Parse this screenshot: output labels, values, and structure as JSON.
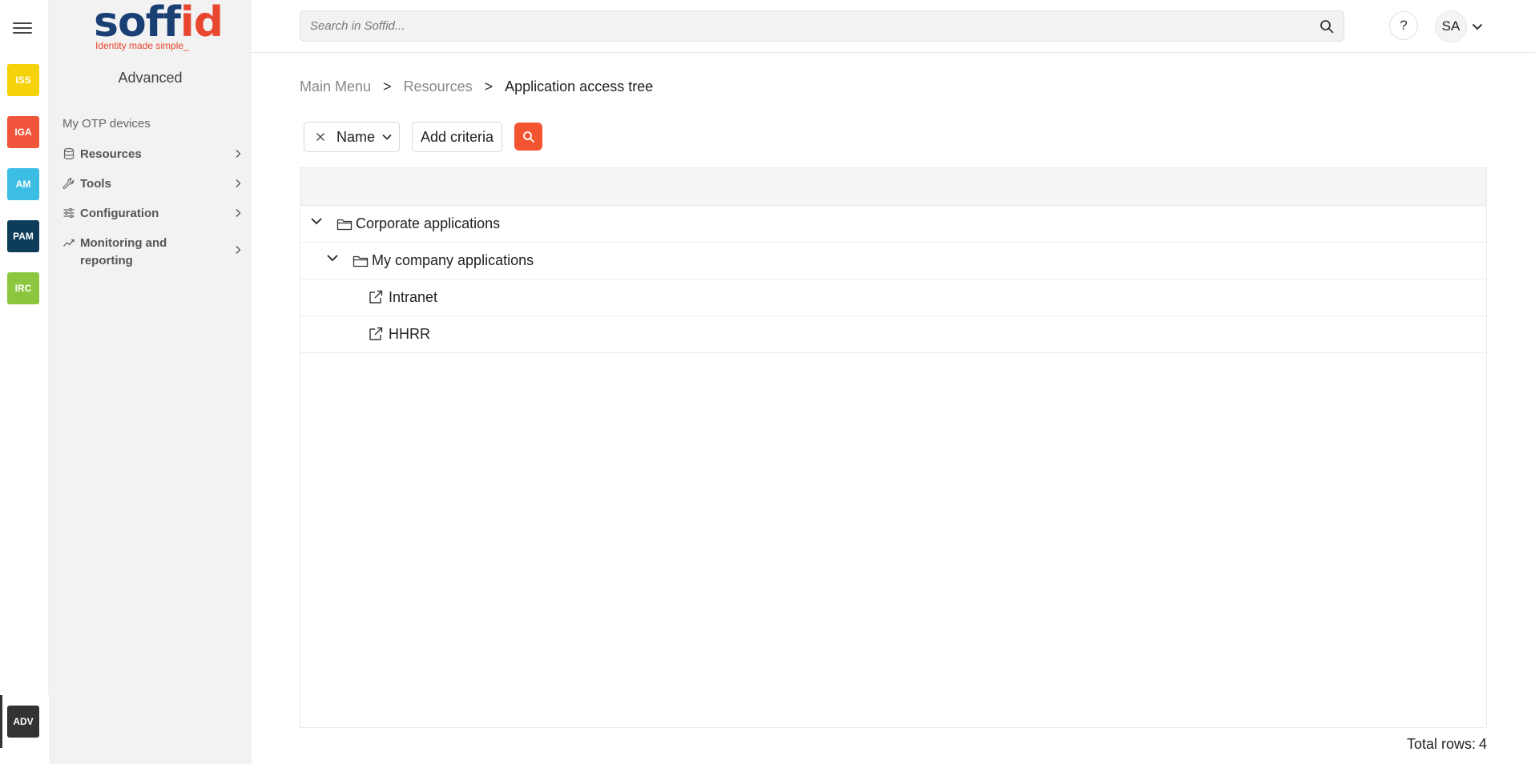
{
  "rail": {
    "modules": [
      {
        "label": "ISS",
        "color": "#f5d20a"
      },
      {
        "label": "IGA",
        "color": "#f0553b"
      },
      {
        "label": "AM",
        "color": "#3bbde4"
      },
      {
        "label": "PAM",
        "color": "#0e3d5c"
      },
      {
        "label": "IRC",
        "color": "#8cc63f"
      }
    ],
    "active_module": {
      "label": "ADV",
      "color": "#333333"
    }
  },
  "brand": {
    "word_main": "soff",
    "word_accent": "id",
    "tagline": "Identity made simple_"
  },
  "menu": {
    "title": "Advanced",
    "plain_item": "My OTP devices",
    "items": [
      {
        "label": "Resources",
        "icon": "database-icon"
      },
      {
        "label": "Tools",
        "icon": "wrench-icon"
      },
      {
        "label": "Configuration",
        "icon": "sliders-icon"
      },
      {
        "label": "Monitoring and reporting",
        "icon": "chart-line-icon"
      }
    ]
  },
  "topbar": {
    "search_placeholder": "Search in Soffid...",
    "help": "?",
    "user_initials": "SA"
  },
  "breadcrumb": {
    "items": [
      "Main Menu",
      "Resources",
      "Application access tree"
    ],
    "separator": ">"
  },
  "filters": {
    "criteria_label": "Name",
    "add_criteria": "Add criteria"
  },
  "tree": {
    "rows": [
      {
        "label": "Corporate applications",
        "level": 0,
        "type": "folder",
        "expanded": true
      },
      {
        "label": "My company applications",
        "level": 1,
        "type": "folder",
        "expanded": true
      },
      {
        "label": "Intranet",
        "level": 2,
        "type": "link"
      },
      {
        "label": "HHRR",
        "level": 2,
        "type": "link"
      }
    ]
  },
  "footer": {
    "total_label": "Total rows:",
    "total_value": "4"
  },
  "colors": {
    "accent": "#f25530",
    "brand_blue": "#1a3f73",
    "brand_orange": "#e8472f"
  }
}
